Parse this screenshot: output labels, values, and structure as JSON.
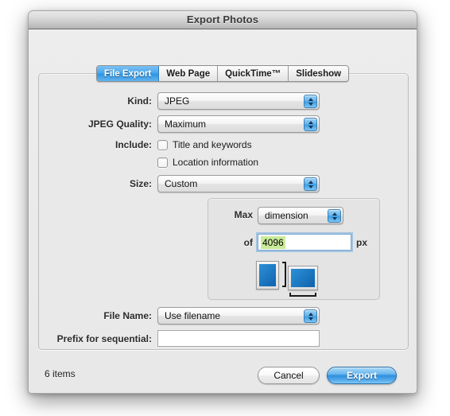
{
  "window": {
    "title": "Export Photos"
  },
  "tabs": [
    {
      "label": "File Export",
      "active": true
    },
    {
      "label": "Web Page",
      "active": false
    },
    {
      "label": "QuickTime™",
      "active": false
    },
    {
      "label": "Slideshow",
      "active": false
    }
  ],
  "form": {
    "kind": {
      "label": "Kind:",
      "value": "JPEG"
    },
    "quality": {
      "label": "JPEG Quality:",
      "value": "Maximum"
    },
    "include": {
      "label": "Include:",
      "options": [
        {
          "label": "Title and keywords",
          "checked": false
        },
        {
          "label": "Location information",
          "checked": false
        }
      ]
    },
    "size": {
      "label": "Size:",
      "value": "Custom"
    },
    "max_group": {
      "max_label": "Max",
      "max_value": "dimension",
      "of_label": "of",
      "of_value": "4096",
      "of_value_selected": true,
      "unit_label": "px",
      "orientation_portrait_icon": "portrait-thumbnail-icon",
      "orientation_landscape_icon": "landscape-thumbnail-icon"
    },
    "file_name": {
      "label": "File Name:",
      "value": "Use filename"
    },
    "prefix": {
      "label": "Prefix for sequential:",
      "value": "",
      "placeholder": ""
    }
  },
  "footer": {
    "count": "6 items",
    "cancel": "Cancel",
    "export": "Export"
  },
  "colors": {
    "accent_blue": "#318fdd",
    "active_tab_blue": "#4aa7ec",
    "selection_green": "#c9eb9a",
    "window_bg": "#ececec",
    "panel_bg": "#e9e9e9",
    "thumb_blue": "#1f7cc4"
  }
}
